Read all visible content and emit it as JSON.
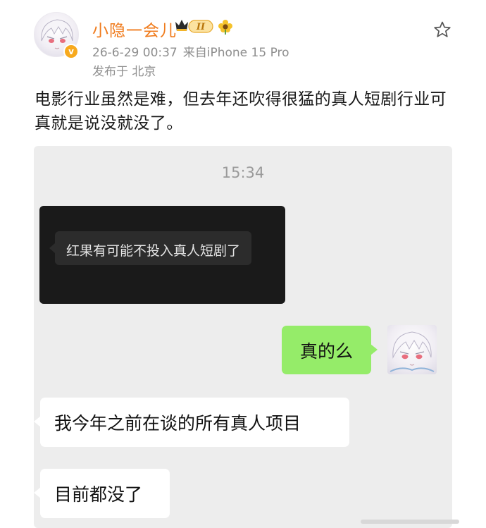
{
  "post": {
    "username": "小隐一会儿",
    "level_badge": "II",
    "time": "26-6-29 00:37",
    "device": "来自iPhone 15 Pro",
    "location": "发布于 北京",
    "text": "电影行业虽然是难，但去年还吹得很猛的真人短剧行业可真就是说没就没了。",
    "verified_mark": "v"
  },
  "icons": {
    "star": "star-icon",
    "flower": "flower-icon",
    "crown": "crown-icon",
    "verified": "verified-icon"
  },
  "chat": {
    "time": "15:34",
    "quoted_message": "红果有可能不投入真人短剧了",
    "messages": [
      {
        "side": "right",
        "text": "真的么"
      },
      {
        "side": "left",
        "text": "我今年之前在谈的所有真人项目"
      },
      {
        "side": "left",
        "text": "目前都没了"
      }
    ]
  },
  "colors": {
    "username": "#f07b1c",
    "meta": "#8e8e8e",
    "chat_bg": "#ededed",
    "bubble_green": "#95ec69",
    "bubble_white": "#ffffff",
    "dark_card": "#1a1a1a"
  }
}
